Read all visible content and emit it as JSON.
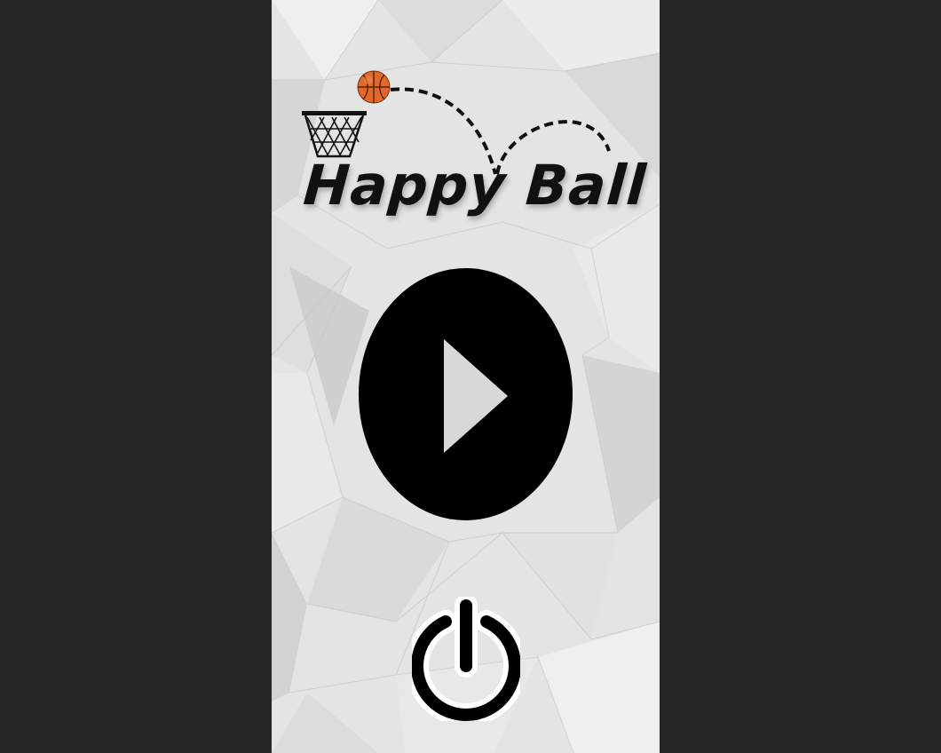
{
  "game": {
    "title": "Happy Ball"
  },
  "buttons": {
    "play_icon": "play-icon",
    "power_icon": "power-icon"
  },
  "colors": {
    "background": "#272727",
    "panel": "#e6e6e6",
    "button": "#000000",
    "ball": "#e0682a"
  }
}
